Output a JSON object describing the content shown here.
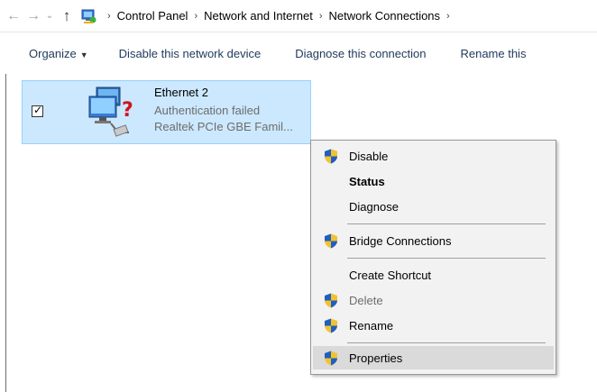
{
  "address_bar": {
    "back_icon": "arrow-left-icon",
    "forward_icon": "arrow-right-icon",
    "recent_icon": "chevron-down-icon",
    "up_icon": "arrow-up-icon",
    "location_icon": "control-panel-icon",
    "breadcrumbs": [
      "Control Panel",
      "Network and Internet",
      "Network Connections"
    ],
    "separator": "›"
  },
  "command_bar": {
    "organize": "Organize",
    "disable_device": "Disable this network device",
    "diagnose": "Diagnose this connection",
    "rename": "Rename this"
  },
  "connection": {
    "name": "Ethernet 2",
    "status": "Authentication failed",
    "adapter": "Realtek PCIe GBE Famil...",
    "checked": true,
    "check_glyph": "✓"
  },
  "context_menu": {
    "items": [
      {
        "label": "Disable",
        "shield": true
      },
      {
        "label": "Status",
        "bold": true
      },
      {
        "label": "Diagnose"
      },
      {
        "label": "Bridge Connections",
        "shield": true
      },
      {
        "label": "Create Shortcut"
      },
      {
        "label": "Delete",
        "shield": true,
        "disabled": true
      },
      {
        "label": "Rename",
        "shield": true
      },
      {
        "label": "Properties",
        "shield": true,
        "highlighted": true
      }
    ]
  },
  "colors": {
    "selection_bg": "#cce8ff",
    "selection_border": "#99d1ff",
    "command_text": "#1e395b",
    "menu_bg": "#f2f2f2",
    "menu_hover": "#dadada"
  }
}
